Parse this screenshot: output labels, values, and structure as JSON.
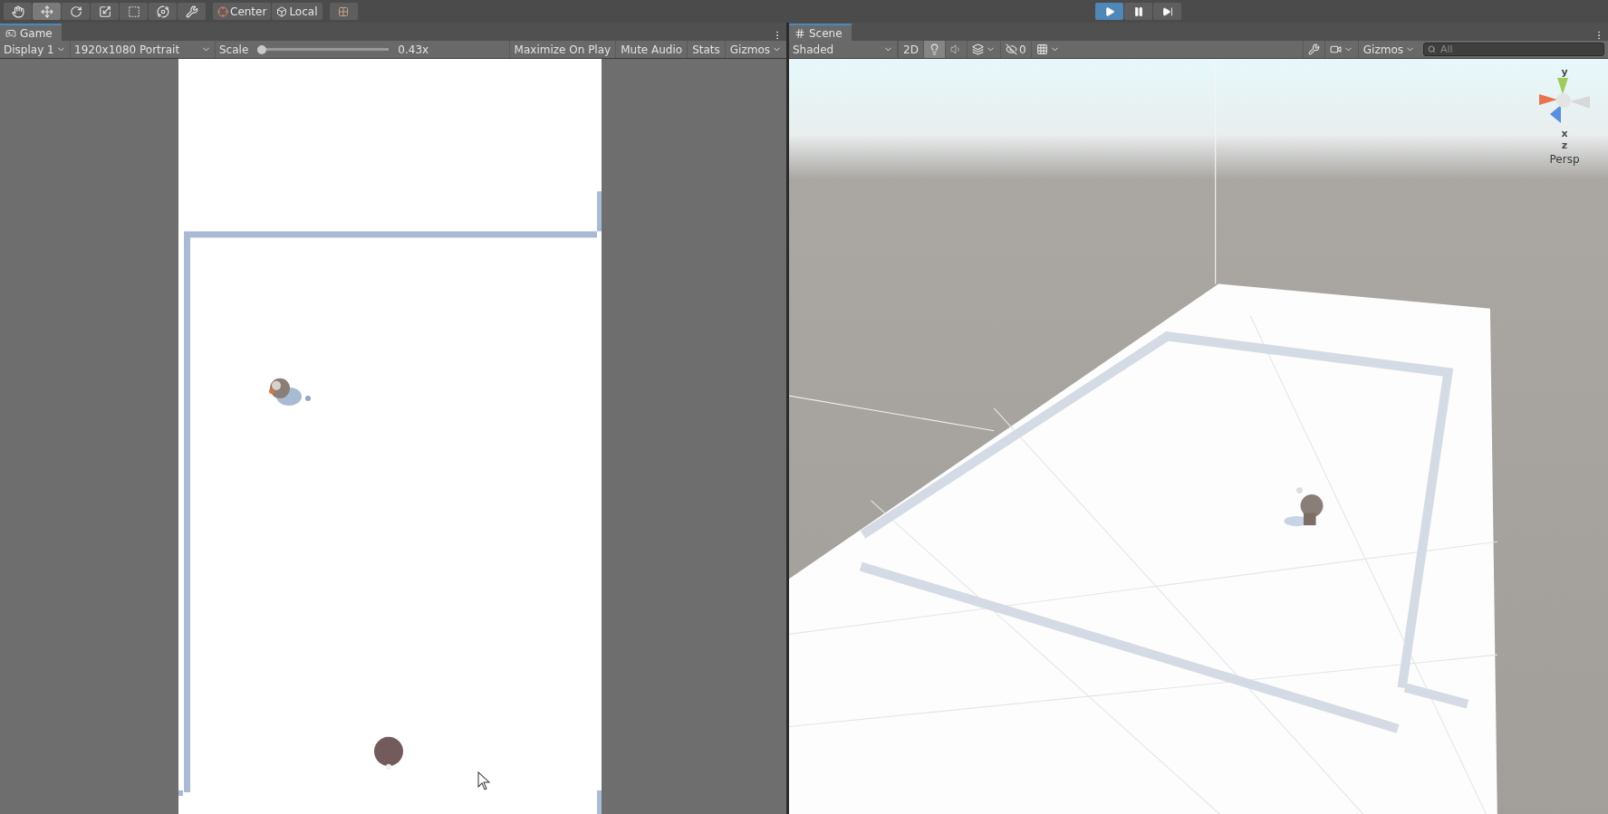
{
  "toolbar": {
    "tools": [
      {
        "kind": "hand",
        "selected": false
      },
      {
        "kind": "move",
        "selected": true
      },
      {
        "kind": "rotate",
        "selected": false
      },
      {
        "kind": "scale",
        "selected": false
      },
      {
        "kind": "rect",
        "selected": false
      },
      {
        "kind": "transform",
        "selected": false
      },
      {
        "kind": "custom",
        "selected": false
      }
    ],
    "pivot": [
      {
        "kind": "center",
        "label": "Center"
      },
      {
        "kind": "local",
        "label": "Local"
      }
    ],
    "play_controls": [
      {
        "kind": "play",
        "selected": true
      },
      {
        "kind": "pause",
        "selected": false
      },
      {
        "kind": "step",
        "selected": false
      }
    ]
  },
  "game": {
    "tab": "Game",
    "display": "Display 1",
    "resolution": "1920x1080 Portrait",
    "scale_label": "Scale",
    "scale": {
      "level": 0
    },
    "scale_reading": "0.43x",
    "buttons": [
      "Maximize On Play",
      "Mute Audio",
      "Stats",
      "Gizmos"
    ]
  },
  "scene": {
    "tab": "Scene",
    "shading": "Shaded",
    "toggles": [
      {
        "kind": "flat",
        "label": "2D",
        "on": false
      },
      {
        "kind": "light",
        "on": true
      },
      {
        "kind": "audio",
        "on": false
      },
      {
        "kind": "effects",
        "on": false
      },
      {
        "kind": "hidden",
        "label": "0",
        "on": false
      },
      {
        "kind": "grid",
        "on": false
      }
    ],
    "gizmos": "Gizmos",
    "search": {
      "placeholder": "All"
    },
    "axes": [
      "y",
      "x",
      "z"
    ],
    "projection": "Persp"
  }
}
